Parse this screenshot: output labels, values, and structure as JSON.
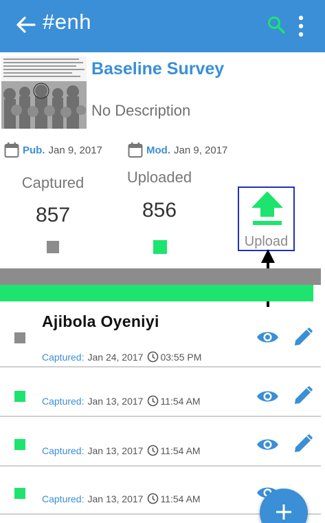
{
  "appbar": {
    "title": "#enh"
  },
  "survey": {
    "title": "Baseline Survey",
    "description": "No Description",
    "published_label": "Pub.",
    "published_date": "Jan 9, 2017",
    "modified_label": "Mod.",
    "modified_date": "Jan 9, 2017",
    "thumbnail_caption": "The circled kid is the current president of Gabon Ali Bongo, the pic was taken in an orphanage before he was adopted by Omar Bongo. For those of you who are too quick to conclude me where think twice. Even the destiny you would today could be you... tomorrow. Life if full of surprises. God is always different."
  },
  "stats": {
    "captured_label": "Captured",
    "captured_value": "857",
    "uploaded_label": "Uploaded",
    "uploaded_value": "856",
    "upload_label": "Upload"
  },
  "progress": {
    "uploaded_fraction": 0.977
  },
  "records": [
    {
      "name": "Ajibola Oyeniyi",
      "captured_label": "Captured:",
      "date": "Jan 24, 2017",
      "time": "03:55 PM",
      "status": "captured"
    },
    {
      "name": "",
      "captured_label": "Captured:",
      "date": "Jan 13, 2017",
      "time": "11:54 AM",
      "status": "uploaded"
    },
    {
      "name": "",
      "captured_label": "Captured:",
      "date": "Jan 13, 2017",
      "time": "11:54 AM",
      "status": "uploaded"
    },
    {
      "name": "",
      "captured_label": "Captured:",
      "date": "Jan 13, 2017",
      "time": "11:54 AM",
      "status": "uploaded"
    }
  ],
  "colors": {
    "primary": "#3a8fd6",
    "green": "#1de46e",
    "gray": "#8c8c8c",
    "annotation_box": "#1f2fbf"
  },
  "icons": {
    "back": "arrow-left-icon",
    "search": "search-icon",
    "more": "more-vert-icon",
    "calendar": "calendar-icon",
    "upload": "upload-icon",
    "clock": "clock-icon",
    "view": "eye-icon",
    "edit": "pencil-icon",
    "add": "plus-icon"
  }
}
